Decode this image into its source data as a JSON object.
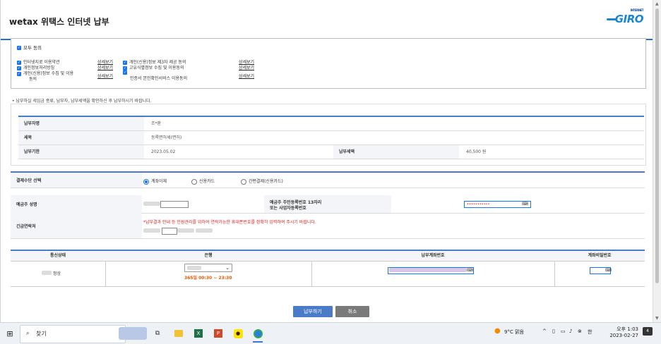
{
  "header": {
    "title": "wetax 위택스 인터넷 납부",
    "logo_text": "GIRO",
    "logo_sup": "INTERNET"
  },
  "consent": {
    "all_label": "모두 동의",
    "left_items": [
      {
        "label": "인터넷지로 이용약관",
        "link": "상세보기"
      },
      {
        "label": "개인정보처리방침",
        "link": "상세보기"
      },
      {
        "label": "개인(신용)정보 수집 및 이용",
        "label2": "동의",
        "link": "상세보기"
      }
    ],
    "right_items": [
      {
        "label": "개인(신용)정보 제3자 제공 동의",
        "link": "상세보기"
      },
      {
        "label": "고유식별정보 수집 및 이용동의",
        "link": "상세보기"
      },
      {
        "label": "인증서 본인확인서비스 이용동의",
        "link": "상세보기"
      }
    ]
  },
  "notice": "• 납부하실 세입금 종류, 납부자, 납부세액을 확인하신 후 납부하시기 바랍니다.",
  "info": {
    "payer_label": "납부자명",
    "payer_value": "조*환",
    "tax_label": "세목",
    "tax_value": "등록면허세(면허)",
    "due_label": "납부기한",
    "due_value": "2023.05.02",
    "amount_label": "납부세액",
    "amount_value": "40,500 원"
  },
  "payment": {
    "method_label": "결제수단 선택",
    "methods": [
      "계좌이체",
      "신용카드",
      "간편결제(신용카드)"
    ],
    "selected": "계좌이체",
    "depositor_label": "예금주 성명",
    "rrn_label": "예금주 주민등록번호 13자리",
    "rrn_label2": "또는 사업자등록번호",
    "rrn_value": "•••••••••••",
    "contact_label": "긴급연락처",
    "contact_notice": "*납부결과 안내 등 민원관리를 위하여 연락가능한 휴대폰번호를 정확히 입력하여 주시기 바랍니다."
  },
  "bank_table": {
    "headers": [
      "통신상태",
      "은행",
      "납부계좌번호",
      "계좌비밀번호"
    ],
    "status": "정상",
    "hours": "365일 00:30 ~ 23:30"
  },
  "buttons": {
    "pay": "납부하기",
    "cancel": "취소"
  },
  "taskbar": {
    "search_placeholder": "찾기",
    "weather": "9°C 맑음",
    "ime": "한",
    "time": "오후 1:03",
    "date": "2023-02-27",
    "notif_count": "4"
  }
}
